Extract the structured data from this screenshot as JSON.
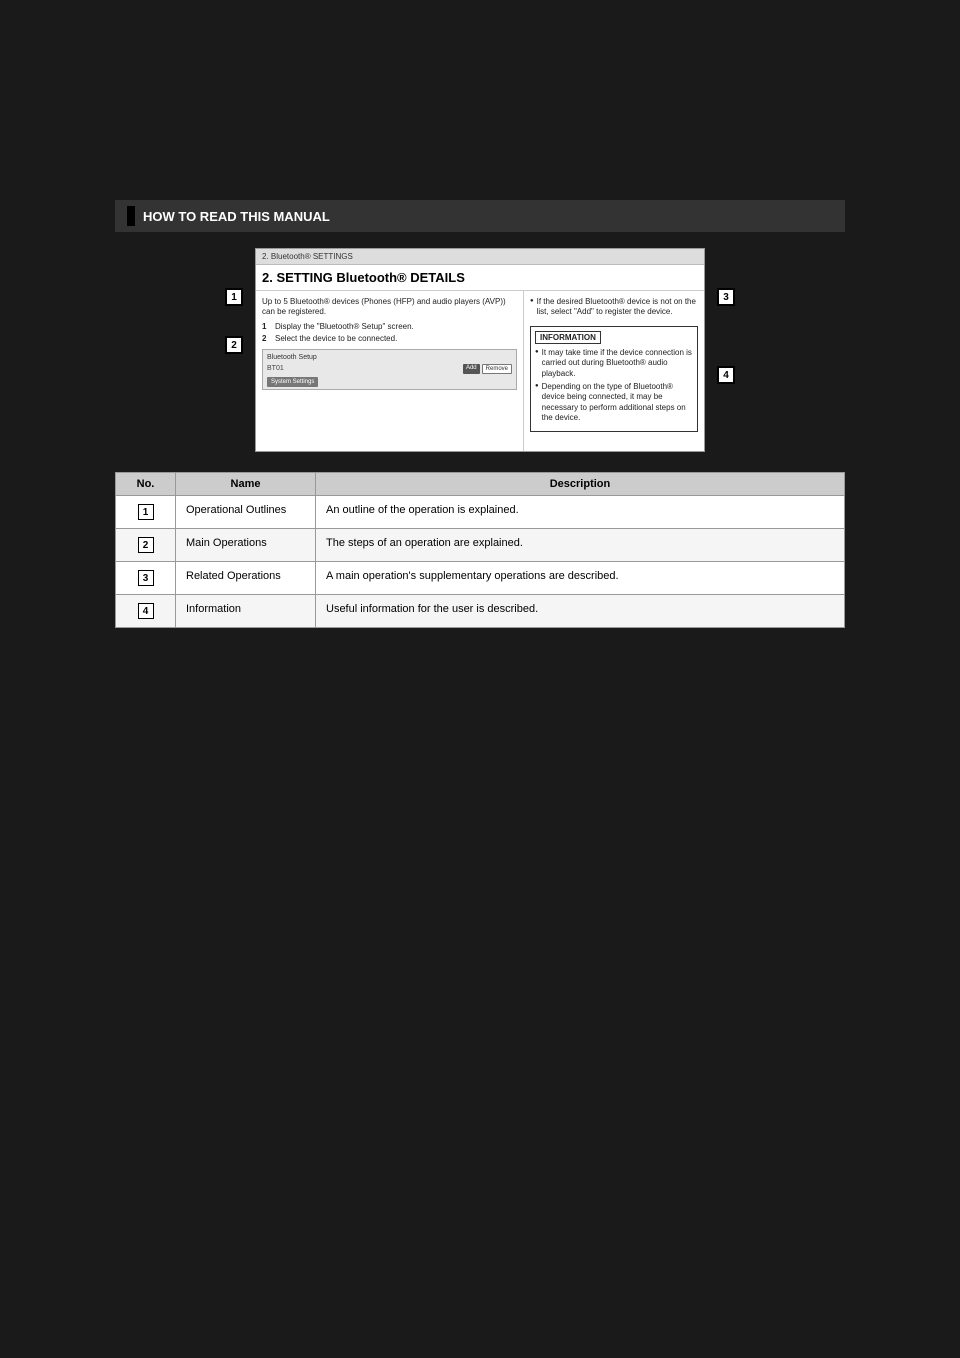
{
  "page": {
    "background": "#1a1a1a"
  },
  "section_header": {
    "label": "HOW TO READ THIS MANUAL"
  },
  "screen_mockup": {
    "title_bar": "2. Bluetooth® SETTINGS",
    "heading": "2. SETTING Bluetooth® DETAILS",
    "left_panel": {
      "description": "Up to 5 Bluetooth® devices (Phones (HFP) and audio players (AVP)) can be registered.",
      "steps": [
        {
          "num": "1",
          "text": "Display the \"Bluetooth® Setup\" screen."
        },
        {
          "num": "2",
          "text": "Select the device to be connected."
        }
      ],
      "inner_mockup": {
        "title": "Bluetooth Setup",
        "list_item": "BT01",
        "buttons": [
          "Add",
          "Remove"
        ],
        "system_button": "System Settings"
      }
    },
    "right_panel": {
      "bullet1": "If the desired Bluetooth® device is not on the list, select \"Add\" to register the device.",
      "info_box": {
        "title": "INFORMATION",
        "bullets": [
          "It may take time if the device connection is carried out during Bluetooth® audio playback.",
          "Depending on the type of Bluetooth® device being connected, it may be necessary to perform additional steps on the device."
        ]
      }
    }
  },
  "table": {
    "columns": [
      "No.",
      "Name",
      "Description"
    ],
    "rows": [
      {
        "no": "1",
        "name": "Operational Outlines",
        "description": "An outline of the operation is explained."
      },
      {
        "no": "2",
        "name": "Main Operations",
        "description": "The steps of an operation are explained."
      },
      {
        "no": "3",
        "name": "Related Operations",
        "description": "A main operation's supplementary operations are described."
      },
      {
        "no": "4",
        "name": "Information",
        "description": "Useful information for the user is described."
      }
    ]
  }
}
